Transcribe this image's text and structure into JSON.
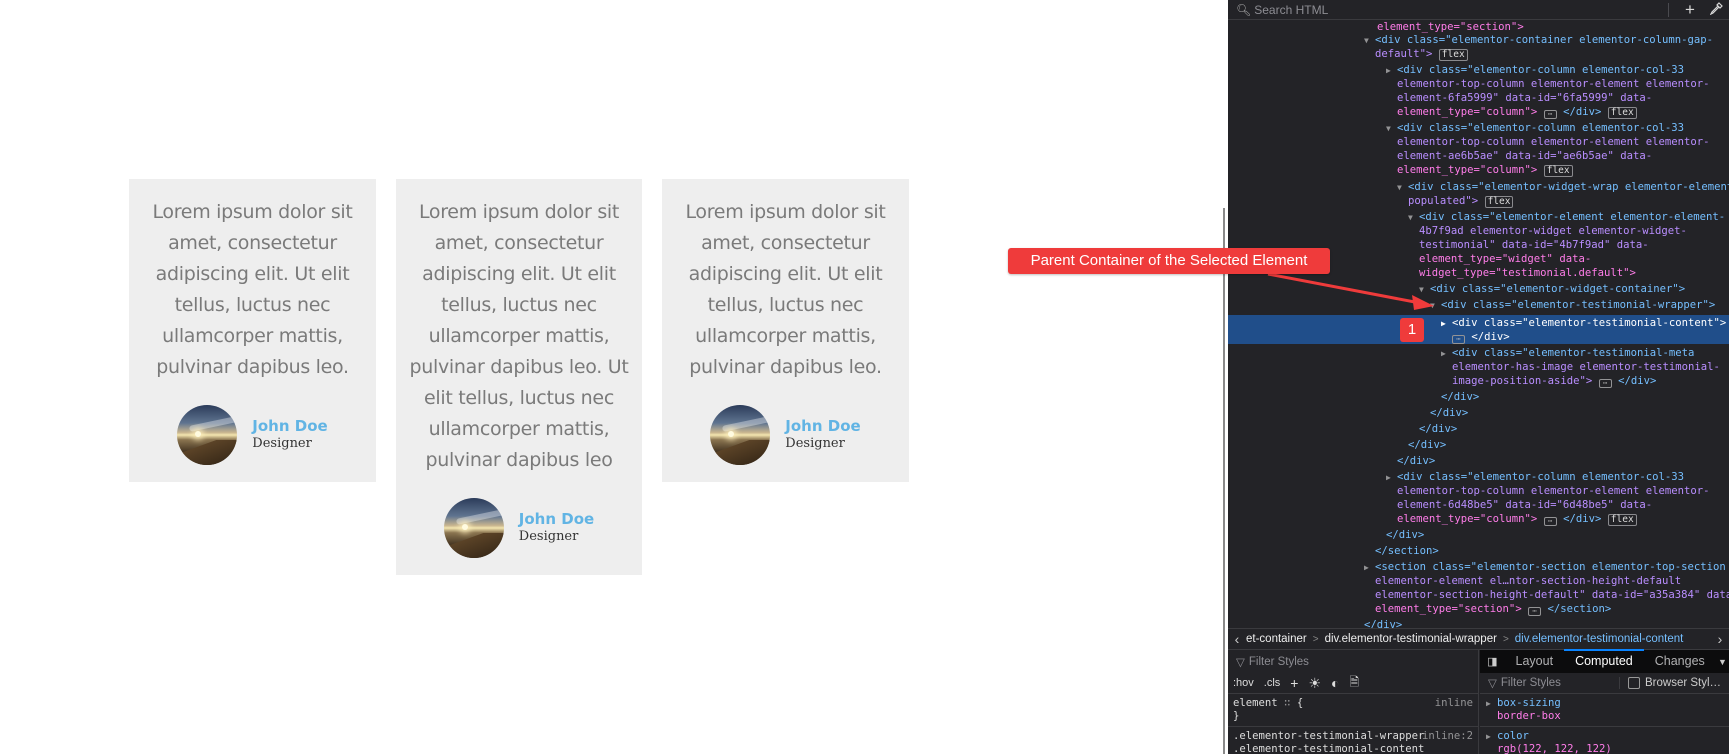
{
  "page": {
    "testimonials": [
      {
        "quote": "Lorem ipsum dolor sit amet, consectetur adipiscing elit. Ut elit tellus, luctus nec ullamcorper mattis, pulvinar dapibus leo.",
        "name": "John Doe",
        "title": "Designer"
      },
      {
        "quote": "Lorem ipsum dolor sit amet, consectetur adipiscing elit. Ut elit tellus, luctus nec ullamcorper mattis, pulvinar dapibus leo. Ut elit tellus, luctus nec ullamcorper mattis, pulvinar dapibus leo",
        "name": "John Doe",
        "title": "Designer"
      },
      {
        "quote": "Lorem ipsum dolor sit amet, consectetur adipiscing elit. Ut elit tellus, luctus nec ullamcorper mattis, pulvinar dapibus leo.",
        "name": "John Doe",
        "title": "Designer"
      }
    ]
  },
  "annotation": {
    "callout_label": "Parent Container of the Selected Element",
    "badge_label": "1",
    "color": "#ef3b3b"
  },
  "devtools": {
    "search_placeholder": "Search HTML",
    "add_node_icon": "+",
    "picker_icon": "eyedropper",
    "tree": {
      "l1": "element_type=\"section\">",
      "l2a": "<div class=\"elementor-container elementor-column-gap-",
      "l2b": "default\">",
      "l3a": "<div class=\"elementor-column elementor-col-33",
      "l3b": "elementor-top-column elementor-element elementor-",
      "l3c": "element-6fa5999\" data-id=\"6fa5999\" data-",
      "l3d": "element_type=\"column\">",
      "l4a": "<div class=\"elementor-column elementor-col-33",
      "l4b": "elementor-top-column elementor-element elementor-",
      "l4c": "element-ae6b5ae\" data-id=\"ae6b5ae\" data-",
      "l4d": "element_type=\"column\">",
      "l5a": "<div class=\"elementor-widget-wrap elementor-element-",
      "l5b": "populated\">",
      "l6a": "<div class=\"elementor-element elementor-element-",
      "l6b": "4b7f9ad elementor-widget elementor-widget-",
      "l6c": "testimonial\" data-id=\"4b7f9ad\" data-",
      "l6d": "element_type=\"widget\" data-",
      "l6e": "widget_type=\"testimonial.default\">",
      "l7": "<div class=\"elementor-widget-container\">",
      "l8": "<div class=\"elementor-testimonial-wrapper\">",
      "l9a": "<div class=\"elementor-testimonial-content\">",
      "l9b": "</div>",
      "l10a": "<div class=\"elementor-testimonial-meta",
      "l10b": "elementor-has-image elementor-testimonial-",
      "l10c": "image-position-aside\">",
      "l10d": "</div>",
      "close": "</div>",
      "l11a": "<div class=\"elementor-column elementor-col-33",
      "l11b": "elementor-top-column elementor-element elementor-",
      "l11c": "element-6d48be5\" data-id=\"6d48be5\" data-",
      "l11d": "element_type=\"column\">",
      "close_section": "</section>",
      "l12a": "<section class=\"elementor-section elementor-top-section",
      "l12b": "elementor-element el…ntor-section-height-default",
      "l12c": "elementor-section-height-default\" data-id=\"a35a384\" data-",
      "l12d": "element_type=\"section\">",
      "flex_badge": "flex",
      "ellipsis": "⋯"
    },
    "breadcrumbs": [
      "et-container",
      "div.elementor-testimonial-wrapper",
      "div.elementor-testimonial-content"
    ],
    "rules": {
      "filter_placeholder": "Filter Styles",
      "hov": ":hov",
      "cls": ".cls",
      "element_rule": "element",
      "element_src": "inline",
      "close_brace": "}",
      "open_brace": "{",
      "selector2": ".elementor-testimonial-wrapper",
      "selector2_line2": ".elementor-testimonial-content",
      "selector2_src": "inline:2"
    },
    "sidebar": {
      "tabs": [
        "Layout",
        "Computed",
        "Changes"
      ],
      "active_tab": "Computed",
      "filter_placeholder": "Filter Styles",
      "browser_styles_label": "Browser Styl…",
      "properties": [
        {
          "name": "box-sizing",
          "value": "border-box"
        },
        {
          "name": "color",
          "value": "rgb(122, 122, 122)"
        }
      ]
    }
  }
}
